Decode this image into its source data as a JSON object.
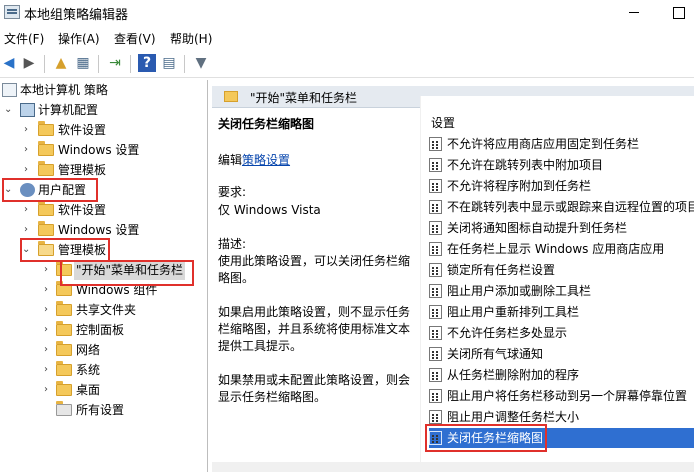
{
  "window": {
    "title": "本地组策略编辑器"
  },
  "menu": [
    "文件(F)",
    "操作(A)",
    "查看(V)",
    "帮助(H)"
  ],
  "tree": {
    "root": "本地计算机 策略",
    "computer_config": "计算机配置",
    "computer_children": [
      "软件设置",
      "Windows 设置",
      "管理模板"
    ],
    "user_config": "用户配置",
    "user_children": [
      "软件设置",
      "Windows 设置",
      "管理模板"
    ],
    "admin_templates_children": [
      "\"开始\"菜单和任务栏",
      "Windows 组件",
      "共享文件夹",
      "控制面板",
      "网络",
      "系统",
      "桌面",
      "所有设置"
    ]
  },
  "details": {
    "header": "\"开始\"菜单和任务栏",
    "setting_title": "关闭任务栏缩略图",
    "edit_prefix": "编辑",
    "edit_link": "策略设置",
    "requirement_label": "要求:",
    "requirement_value": "仅 Windows Vista",
    "desc_label": "描述:",
    "desc_lines": [
      "使用此策略设置，可以关闭任务栏缩",
      "略图。",
      "",
      "如果启用此策略设置，则不显示任务",
      "栏缩略图，并且系统将使用标准文本",
      "提供工具提示。",
      "",
      "如果禁用或未配置此策略设置，则会",
      "显示任务栏缩略图。"
    ]
  },
  "settings": {
    "column_header": "设置",
    "items": [
      "不允许将应用商店应用固定到任务栏",
      "不允许在跳转列表中附加项目",
      "不允许将程序附加到任务栏",
      "不在跳转列表中显示或跟踪来自远程位置的项目",
      "关闭将通知图标自动提升到任务栏",
      "在任务栏上显示 Windows 应用商店应用",
      "锁定所有任务栏设置",
      "阻止用户添加或删除工具栏",
      "阻止用户重新排列工具栏",
      "不允许任务栏多处显示",
      "关闭所有气球通知",
      "从任务栏删除附加的程序",
      "阻止用户将任务栏移动到另一个屏幕停靠位置",
      "阻止用户调整任务栏大小",
      "关闭任务栏缩略图"
    ],
    "selected_index": 14
  },
  "colors": {
    "selection": "#2f6fd1",
    "highlight_box": "#e0302b",
    "link": "#0645ad"
  }
}
